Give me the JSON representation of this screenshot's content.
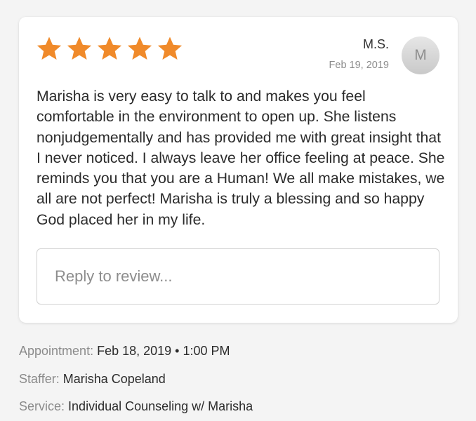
{
  "review": {
    "rating": 5,
    "max_rating": 5,
    "star_color": "#F08A2A",
    "reviewer_name": "M.S.",
    "reviewer_date": "Feb 19, 2019",
    "avatar_initial": "M",
    "text": "Marisha is very easy to talk to and makes you feel comfortable in the environment to open up. She listens nonjudgementally and has provided me with great insight that I never noticed. I always leave her office feeling at peace. She reminds you that you are a Human! We all make mistakes, we all are not perfect! Marisha is truly a blessing and so happy God placed her in my life.",
    "reply_placeholder": "Reply to review..."
  },
  "details": {
    "appointment_label": "Appointment:",
    "appointment_value": "Feb 18, 2019 • 1:00 PM",
    "staffer_label": "Staffer:",
    "staffer_value": "Marisha Copeland",
    "service_label": "Service:",
    "service_value": "Individual Counseling w/ Marisha"
  }
}
